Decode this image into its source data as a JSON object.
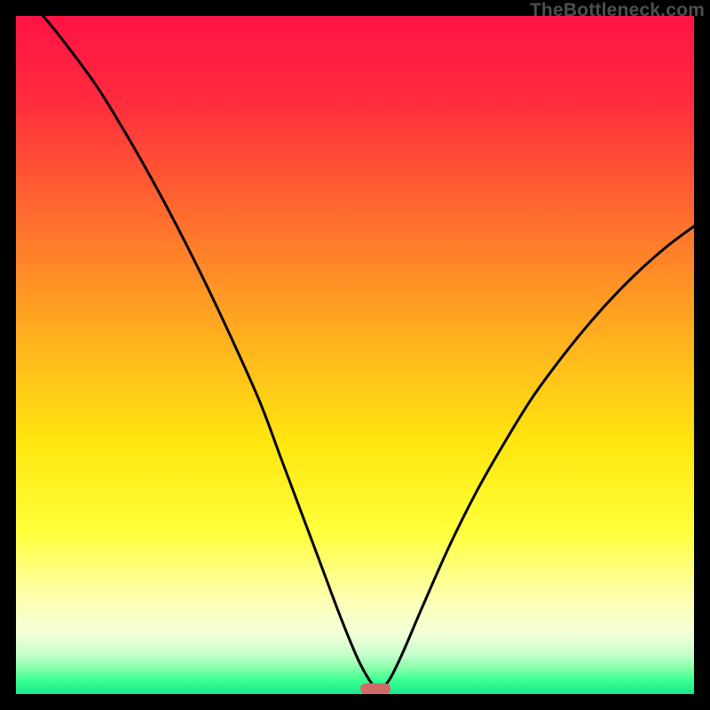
{
  "watermark": "TheBottleneck.com",
  "colors": {
    "frame": "#000000",
    "curve": "#000000",
    "marker": "#cf6a67",
    "gradient_stops": [
      {
        "pct": 0,
        "color": "#ff1345"
      },
      {
        "pct": 12,
        "color": "#ff2a3e"
      },
      {
        "pct": 30,
        "color": "#ff6e2e"
      },
      {
        "pct": 48,
        "color": "#ffb21e"
      },
      {
        "pct": 63,
        "color": "#ffe60f"
      },
      {
        "pct": 76,
        "color": "#ffff3a"
      },
      {
        "pct": 86,
        "color": "#fdffb1"
      },
      {
        "pct": 91,
        "color": "#f3ffd8"
      },
      {
        "pct": 94,
        "color": "#c9ffce"
      },
      {
        "pct": 96,
        "color": "#8effac"
      },
      {
        "pct": 98,
        "color": "#3aff92"
      },
      {
        "pct": 100,
        "color": "#17e98a"
      }
    ]
  },
  "chart_data": {
    "type": "line",
    "title": "",
    "xlabel": "",
    "ylabel": "",
    "xlim": [
      0,
      100
    ],
    "ylim": [
      0,
      100
    ],
    "grid": false,
    "legend": false,
    "optimal_x": 53.5,
    "marker": {
      "x": 53.0,
      "y": 0.8,
      "width_pct": 4.4,
      "height_pct": 1.6
    },
    "series": [
      {
        "name": "bottleneck",
        "x": [
          0,
          4,
          8,
          12,
          16,
          20,
          24,
          28,
          32,
          36,
          39,
          42,
          45,
          48,
          50.5,
          52.5,
          53.5,
          55,
          57,
          60,
          64,
          68,
          72,
          76,
          80,
          84,
          88,
          92,
          96,
          100
        ],
        "y": [
          104,
          100,
          95,
          89.5,
          83,
          76,
          68.5,
          60.5,
          52,
          43,
          35,
          27,
          19,
          11,
          5,
          1.5,
          0.8,
          2,
          6,
          13,
          22,
          30,
          37,
          43.5,
          49,
          54,
          58.5,
          62.5,
          66,
          69
        ]
      }
    ]
  }
}
